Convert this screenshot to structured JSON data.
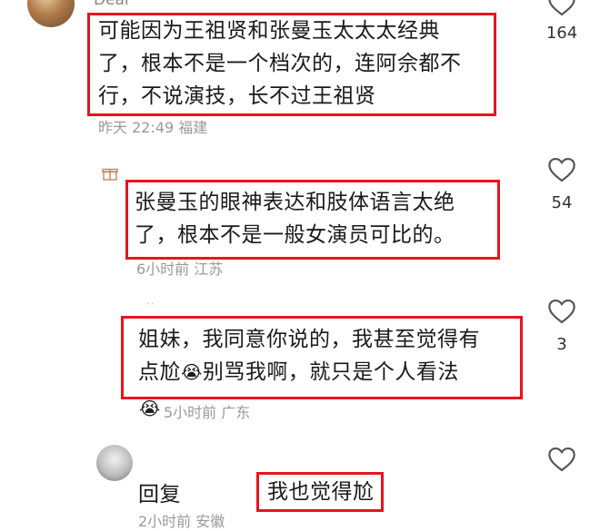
{
  "comments": [
    {
      "username": "Dear",
      "text": "可能因为王祖贤和张曼玉太太太经典了，根本不是一个档次的，连阿佘都不行，不说演技，长不过王祖贤",
      "line1": "可能因为王祖贤和张曼玉太太太经典",
      "line2": "了，根本不是一个档次的，连阿佘都不",
      "line3": "行，不说演技，长不过王祖贤",
      "time": "昨天 22:49",
      "location": "福建",
      "likes": "164"
    },
    {
      "line1": "张曼玉的眼神表达和肢体语言太绝",
      "line2": "了，根本不是一般女演员可比的。",
      "time": "6小时前",
      "location": "江苏",
      "likes": "54"
    },
    {
      "line1": "姐妹，我同意你说的，我甚至觉得有",
      "line2a": "点尬",
      "emoji": "😭",
      "line2b": "别骂我啊，就只是个人看法",
      "time": "5小时前",
      "location": "广东",
      "likes": "3"
    },
    {
      "reply_label": "回复",
      "text": "我也觉得尬",
      "time": "2小时前",
      "location": "安徽"
    }
  ],
  "icons": {
    "heart": "heart-outline-icon",
    "gift": "gift-icon",
    "emoji_badge": "crying-face-icon"
  },
  "colors": {
    "highlight": "#e8141c"
  }
}
